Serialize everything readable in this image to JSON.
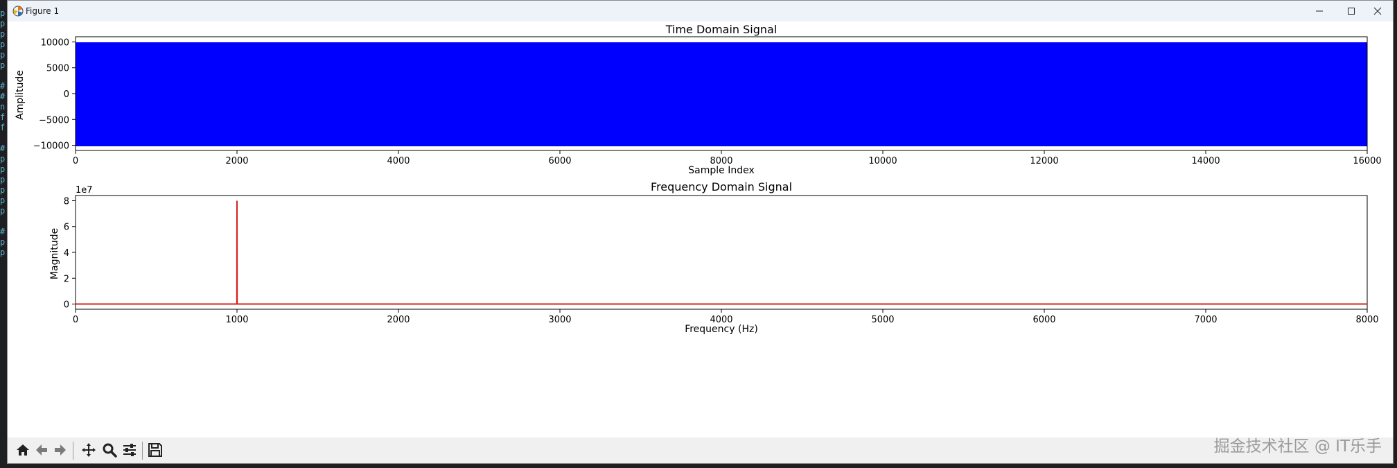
{
  "window": {
    "title": "Figure 1",
    "controls": [
      "minimize",
      "maximize",
      "close"
    ]
  },
  "toolbar": {
    "buttons": [
      "home-icon",
      "back-icon",
      "forward-icon",
      "pan-icon",
      "zoom-icon",
      "configure-subplots-icon",
      "save-icon"
    ]
  },
  "watermark": "掘金技术社区 @ IT乐手",
  "chart_data": [
    {
      "type": "line",
      "title": "Time Domain Signal",
      "xlabel": "Sample Index",
      "ylabel": "Amplitude",
      "xlim": [
        0,
        16000
      ],
      "ylim": [
        -11000,
        11000
      ],
      "xticks": [
        "0",
        "2000",
        "4000",
        "6000",
        "8000",
        "10000",
        "12000",
        "14000",
        "16000"
      ],
      "yticks": [
        "10000",
        "5000",
        "0",
        "−5000",
        "−10000"
      ],
      "series": [
        {
          "color": "#0000ff",
          "description_range": [
            -10000,
            10000
          ],
          "x": [
            0,
            16000
          ]
        }
      ]
    },
    {
      "type": "line",
      "title": "Frequency Domain Signal",
      "xlabel": "Frequency (Hz)",
      "ylabel": "Magnitude",
      "offset_text": "1e7",
      "xlim": [
        0,
        8000
      ],
      "ylim": [
        -4000000,
        84000000
      ],
      "xticks": [
        "0",
        "1000",
        "2000",
        "3000",
        "4000",
        "5000",
        "6000",
        "7000",
        "8000"
      ],
      "yticks": [
        "8",
        "6",
        "4",
        "2",
        "0"
      ],
      "series": [
        {
          "color": "#d62020",
          "x": [
            0,
            999,
            1000,
            1001,
            8000
          ],
          "y": [
            0,
            0,
            80000000,
            0,
            0
          ]
        }
      ]
    }
  ]
}
